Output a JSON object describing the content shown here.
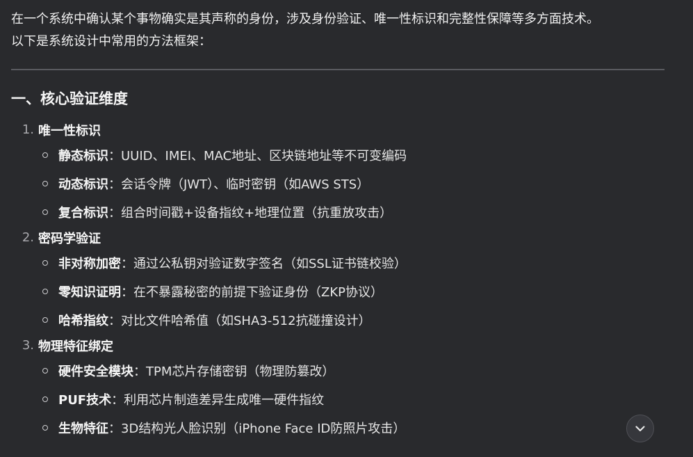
{
  "intro": {
    "line1": "在一个系统中确认某个事物确实是其声称的身份，涉及身份验证、唯一性标识和完整性保障等多方面技术。",
    "line2": "以下是系统设计中常用的方法框架："
  },
  "section": {
    "title": "一、核心验证维度"
  },
  "groups": [
    {
      "number": "1.",
      "label": "唯一性标识",
      "items": [
        {
          "term": "静态标识",
          "sep": "：",
          "desc": "UUID、IMEI、MAC地址、区块链地址等不可变编码"
        },
        {
          "term": "动态标识",
          "sep": "：",
          "desc": "会话令牌（JWT）、临时密钥（如AWS STS）"
        },
        {
          "term": "复合标识",
          "sep": "：",
          "desc": "组合时间戳+设备指纹+地理位置（抗重放攻击）"
        }
      ]
    },
    {
      "number": "2.",
      "label": "密码学验证",
      "items": [
        {
          "term": "非对称加密",
          "sep": "：",
          "desc": "通过公私钥对验证数字签名（如SSL证书链校验）"
        },
        {
          "term": "零知识证明",
          "sep": "：",
          "desc": "在不暴露秘密的前提下验证身份（ZKP协议）"
        },
        {
          "term": "哈希指纹",
          "sep": "：",
          "desc": "对比文件哈希值（如SHA3-512抗碰撞设计）"
        }
      ]
    },
    {
      "number": "3.",
      "label": "物理特征绑定",
      "items": [
        {
          "term": "硬件安全模块",
          "sep": "：",
          "desc": "TPM芯片存储密钥（物理防篡改）"
        },
        {
          "term": "PUF技术",
          "sep": "：",
          "desc": "利用芯片制造差异生成唯一硬件指纹"
        },
        {
          "term": "生物特征",
          "sep": "：",
          "desc": "3D结构光人脸识别（iPhone Face ID防照片攻击）"
        }
      ]
    }
  ],
  "scroll_button": {
    "icon": "chevron-down-icon"
  }
}
